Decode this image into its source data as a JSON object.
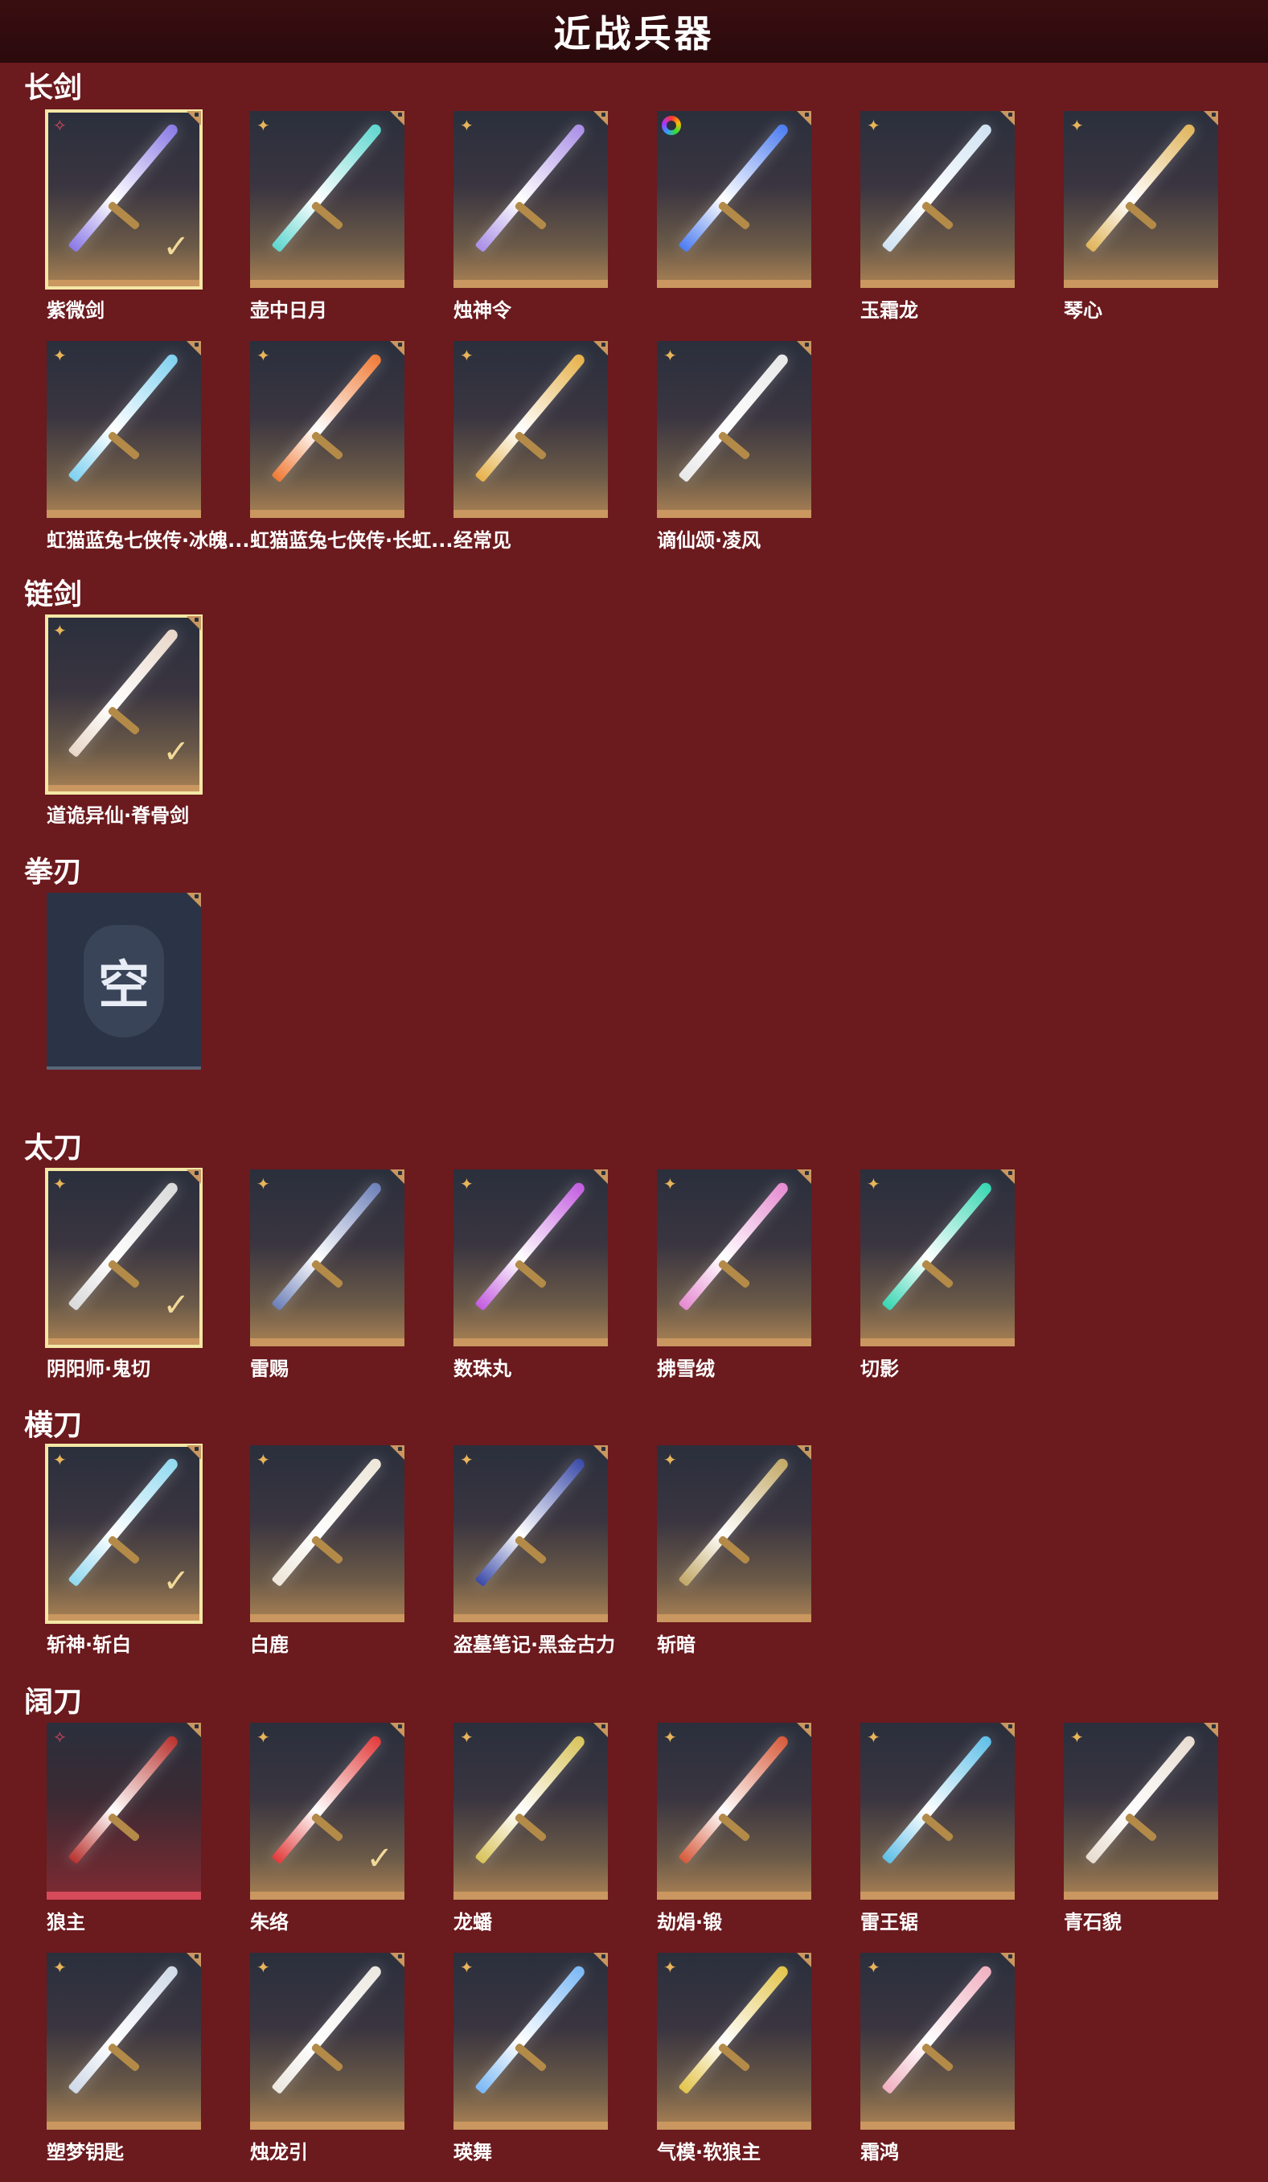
{
  "page_title": "近战兵器",
  "sections": [
    {
      "title": "长剑",
      "items": [
        {
          "name": "紫微剑",
          "badge": "rose",
          "selected": true,
          "check": true,
          "color": "#8a79e6"
        },
        {
          "name": "壶中日月",
          "badge": "star",
          "color": "#5fd6cf"
        },
        {
          "name": "烛神令",
          "badge": "star",
          "color": "#a98ee6"
        },
        {
          "name": "",
          "badge": "ring",
          "color": "#4c7cf0"
        },
        {
          "name": "玉霜龙",
          "badge": "star",
          "color": "#cfe2f2"
        },
        {
          "name": "琴心",
          "badge": "star",
          "color": "#e0b45a"
        },
        {
          "name": "虹猫蓝兔七侠传·冰魄...",
          "badge": "star",
          "color": "#7fd0f0"
        },
        {
          "name": "虹猫蓝兔七侠传·长虹...",
          "badge": "star",
          "color": "#f07a35"
        },
        {
          "name": "经常见",
          "badge": "star",
          "color": "#e6b14a"
        },
        {
          "name": "谪仙颂·凌风",
          "badge": "star",
          "color": "#e8e8e8"
        }
      ]
    },
    {
      "title": "链剑",
      "items": [
        {
          "name": "道诡异仙·脊骨剑",
          "badge": "star",
          "selected": true,
          "check": true,
          "color": "#e8d6c8"
        }
      ]
    },
    {
      "title": "拳刃",
      "items": [
        {
          "name": "",
          "empty": true,
          "empty_text": "空"
        }
      ]
    },
    {
      "title": "太刀",
      "items": [
        {
          "name": "阴阳师·鬼切",
          "badge": "star",
          "selected": true,
          "check": true,
          "color": "#d9d9d9"
        },
        {
          "name": "雷赐",
          "badge": "star",
          "color": "#6c7fb8"
        },
        {
          "name": "数珠丸",
          "badge": "star",
          "color": "#c35ce0"
        },
        {
          "name": "拂雪绒",
          "badge": "star",
          "color": "#e58ad0"
        },
        {
          "name": "切影",
          "badge": "star",
          "color": "#38d6b2"
        }
      ]
    },
    {
      "title": "横刀",
      "items": [
        {
          "name": "斩神·斩白",
          "badge": "star",
          "selected": true,
          "check": true,
          "color": "#8fd8f0"
        },
        {
          "name": "白鹿",
          "badge": "star",
          "color": "#ede6d8"
        },
        {
          "name": "盗墓笔记·黑金古力",
          "badge": "star",
          "color": "#3a4aa8"
        },
        {
          "name": "斩暗",
          "badge": "star",
          "color": "#c2a866"
        }
      ]
    },
    {
      "title": "阔刀",
      "items": [
        {
          "name": "狼主",
          "badge": "rose",
          "red": true,
          "color": "#b8322e"
        },
        {
          "name": "朱络",
          "badge": "star",
          "check": true,
          "color": "#e23a3a"
        },
        {
          "name": "龙蟠",
          "badge": "star",
          "color": "#d8c35a"
        },
        {
          "name": "劫焆·锻",
          "badge": "star",
          "color": "#d65a3a"
        },
        {
          "name": "雷王锯",
          "badge": "star",
          "color": "#5fbfe8"
        },
        {
          "name": "青石貌",
          "badge": "star",
          "color": "#e8dcd0"
        },
        {
          "name": "塑梦钥匙",
          "badge": "star",
          "color": "#cfd9e8"
        },
        {
          "name": "烛龙引",
          "badge": "star",
          "color": "#ece8e0"
        },
        {
          "name": "瑛舞",
          "badge": "star",
          "color": "#7ab8f5"
        },
        {
          "name": "气模·软狼主",
          "badge": "star",
          "color": "#e3c44a"
        },
        {
          "name": "霜鸿",
          "badge": "star",
          "color": "#f0b0c0"
        }
      ]
    }
  ]
}
